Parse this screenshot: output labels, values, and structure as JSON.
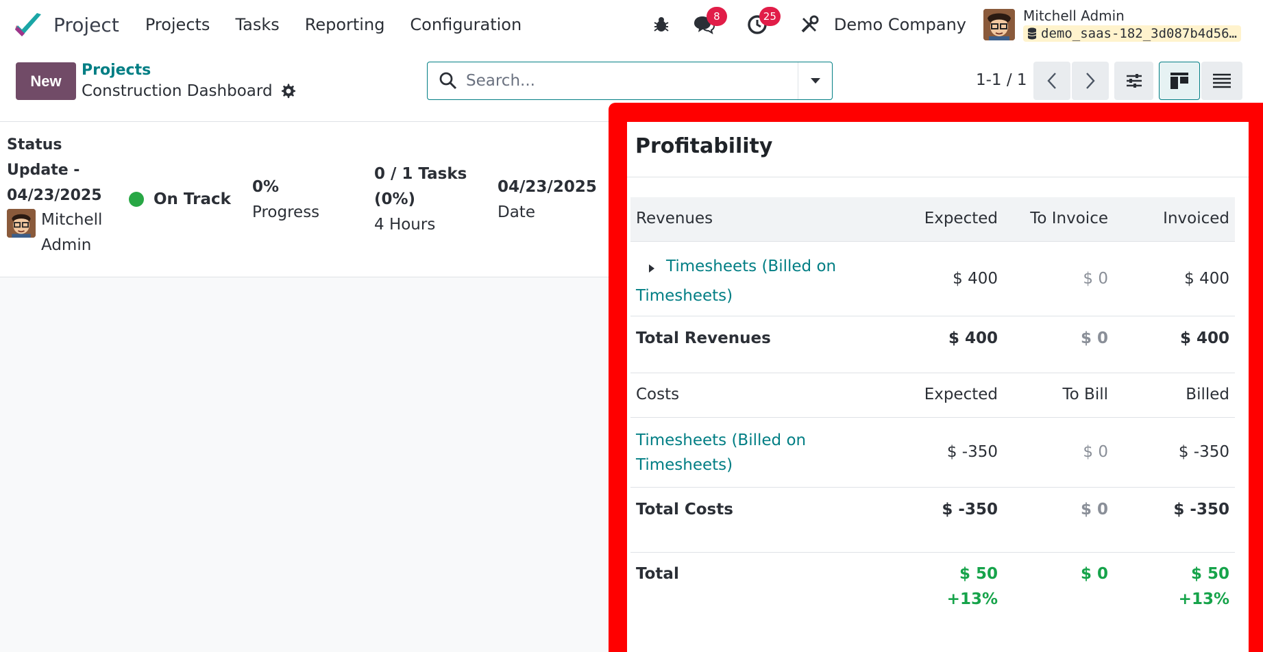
{
  "navbar": {
    "app_name": "Project",
    "menu": [
      "Projects",
      "Tasks",
      "Reporting",
      "Configuration"
    ],
    "messages_badge": "8",
    "activities_badge": "25",
    "company": "Demo Company",
    "user_name": "Mitchell Admin",
    "db_name": "demo_saas-182_3d087b4d56…"
  },
  "control": {
    "new_label": "New",
    "breadcrumb_parent": "Projects",
    "breadcrumb_current": "Construction Dashboard",
    "search_placeholder": "Search...",
    "pager": "1-1 / 1"
  },
  "status": {
    "title": "Status Update - 04/23/2025",
    "user": "Mitchell Admin",
    "state": "On Track",
    "progress_value": "0%",
    "progress_label": "Progress",
    "tasks_value": "0 / 1 Tasks (0%)",
    "hours": "4 Hours",
    "date_value": "04/23/2025",
    "date_label": "Date"
  },
  "profitability": {
    "title": "Profitability",
    "revenues": {
      "header": [
        "Revenues",
        "Expected",
        "To Invoice",
        "Invoiced"
      ],
      "row_label": "Timesheets (Billed on Timesheets)",
      "row_values": [
        "$ 400",
        "$ 0",
        "$ 400"
      ],
      "total_label": "Total Revenues",
      "total_values": [
        "$ 400",
        "$ 0",
        "$ 400"
      ]
    },
    "costs": {
      "header": [
        "Costs",
        "Expected",
        "To Bill",
        "Billed"
      ],
      "row_label": "Timesheets (Billed on Timesheets)",
      "row_values": [
        "$ -350",
        "$ 0",
        "$ -350"
      ],
      "total_label": "Total Costs",
      "total_values": [
        "$ -350",
        "$ 0",
        "$ -350"
      ]
    },
    "total": {
      "label": "Total",
      "expected": "$ 50",
      "expected_pct": "+13%",
      "to_invoice": "$ 0",
      "invoiced": "$ 50",
      "invoiced_pct": "+13%"
    }
  },
  "colors": {
    "brand": "#714b67",
    "link": "#017e84",
    "highlight": "#ff0000",
    "positive": "#16a34a",
    "on_track": "#28a745",
    "badge": "#e11d48"
  }
}
